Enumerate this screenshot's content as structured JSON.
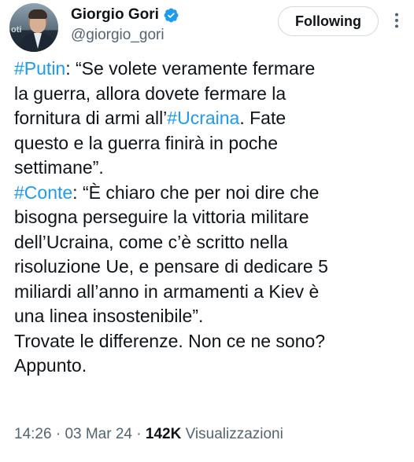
{
  "author": {
    "display_name": "Giorgio Gori",
    "handle": "@giorgio_gori",
    "avatar_bg_text": "oti"
  },
  "follow_button": {
    "label": "Following"
  },
  "tweet": {
    "lines": [
      [
        {
          "t": "#Putin",
          "h": true
        },
        {
          "t": ": “Se volete veramente fermare",
          "h": false
        }
      ],
      [
        {
          "t": "la guerra, allora dovete fermare la",
          "h": false
        }
      ],
      [
        {
          "t": "fornitura di armi all’",
          "h": false
        },
        {
          "t": "#Ucraina",
          "h": true
        },
        {
          "t": ". Fate",
          "h": false
        }
      ],
      [
        {
          "t": "questo e la guerra finirà in poche",
          "h": false
        }
      ],
      [
        {
          "t": "settimane”.",
          "h": false
        }
      ],
      [
        {
          "t": "#Conte",
          "h": true
        },
        {
          "t": ": “È chiaro che per noi dire che",
          "h": false
        }
      ],
      [
        {
          "t": "bisogna perseguire la vittoria militare",
          "h": false
        }
      ],
      [
        {
          "t": "dell’Ucraina, come c’è scritto nella",
          "h": false
        }
      ],
      [
        {
          "t": "risoluzione Ue, e pensare di dedicare 5",
          "h": false
        }
      ],
      [
        {
          "t": "miliardi all’anno in armamenti a Kiev è",
          "h": false
        }
      ],
      [
        {
          "t": "una linea insostenibile”.",
          "h": false
        }
      ],
      [
        {
          "t": "Trovate le differenze. Non ce ne sono?",
          "h": false
        }
      ],
      [
        {
          "t": "Appunto.",
          "h": false
        }
      ]
    ]
  },
  "meta": {
    "time": "14:26",
    "separator": "·",
    "date": "03 Mar 24",
    "views_count": "142K",
    "views_label": "Visualizzazioni"
  },
  "colors": {
    "link": "#1d9bf0",
    "text": "#0f1419",
    "secondary": "#536471",
    "verified": "#1d9bf0"
  },
  "icons": {
    "verified": "verified-badge-icon",
    "more": "more-dots-icon"
  }
}
